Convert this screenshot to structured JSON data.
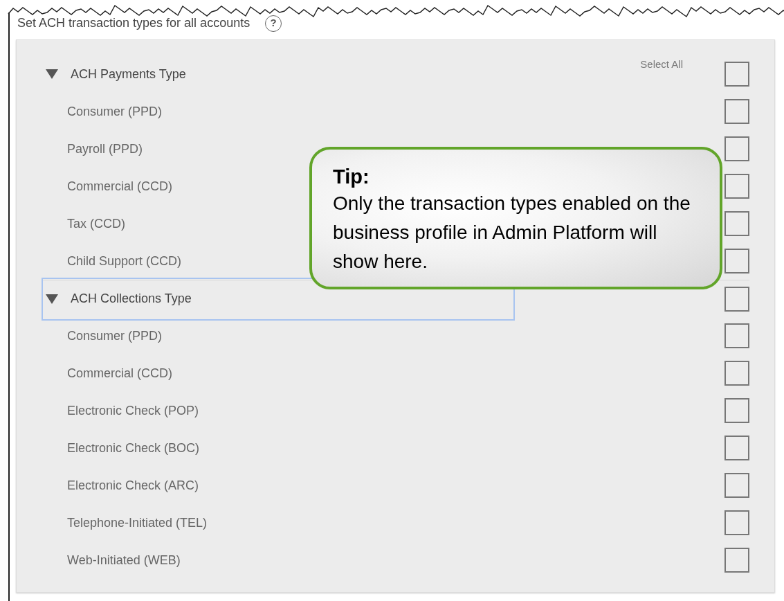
{
  "heading": {
    "title": "Set ACH transaction types for all accounts",
    "help": "?"
  },
  "groups": [
    {
      "title": "ACH Payments Type",
      "expanded": true,
      "focused": false,
      "select_all": "Select All",
      "checked": false,
      "items": [
        {
          "label": "Consumer (PPD)",
          "checked": false
        },
        {
          "label": "Payroll (PPD)",
          "checked": false
        },
        {
          "label": "Commercial (CCD)",
          "checked": false
        },
        {
          "label": "Tax (CCD)",
          "checked": false
        },
        {
          "label": "Child Support (CCD)",
          "checked": false
        }
      ]
    },
    {
      "title": "ACH Collections Type",
      "expanded": true,
      "focused": true,
      "checked": false,
      "items": [
        {
          "label": "Consumer (PPD)",
          "checked": false
        },
        {
          "label": "Commercial (CCD)",
          "checked": false
        },
        {
          "label": "Electronic Check (POP)",
          "checked": false
        },
        {
          "label": "Electronic Check (BOC)",
          "checked": false
        },
        {
          "label": "Electronic Check (ARC)",
          "checked": false
        },
        {
          "label": "Telephone-Initiated (TEL)",
          "checked": false
        },
        {
          "label": "Web-Initiated (WEB)",
          "checked": false
        }
      ]
    }
  ],
  "tip": {
    "title": "Tip:",
    "text": "Only the transaction types enabled on the business profile in Admin Platform will show here."
  }
}
